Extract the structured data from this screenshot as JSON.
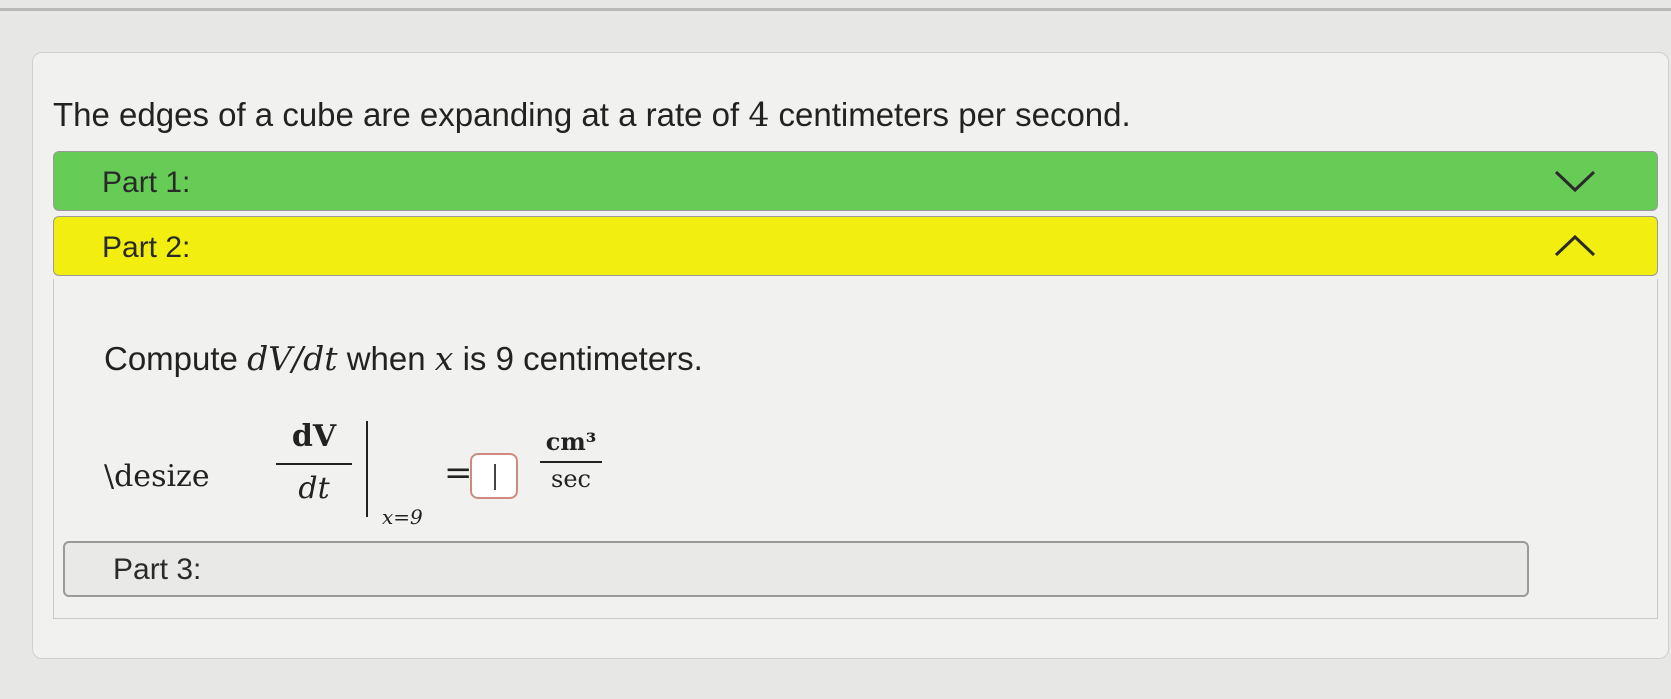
{
  "intro": {
    "text_before": "The edges of a cube are expanding at a rate of ",
    "rate": "4",
    "text_after": " centimeters per second."
  },
  "parts": [
    {
      "label": "Part 1:",
      "state": "collapsed",
      "status_color": "#66cc55",
      "icon": "chevron-down-icon"
    },
    {
      "label": "Part 2:",
      "state": "expanded",
      "status_color": "#f2ee10",
      "icon": "chevron-up-icon"
    },
    {
      "label": "Part 3:",
      "state": "collapsed",
      "status_color": "#e9e9e7"
    }
  ],
  "part2": {
    "prompt_before": "Compute ",
    "prompt_math": "dV/dt",
    "prompt_middle": " when ",
    "prompt_var": "x",
    "prompt_after": " is 9 centimeters.",
    "formula": {
      "prefix": "\\desize",
      "numerator": "dV",
      "denominator": "dt",
      "eval_at": "x=9",
      "equals": "=",
      "answer_value": "",
      "unit_numerator": "cm³",
      "unit_denominator": "sec"
    }
  }
}
